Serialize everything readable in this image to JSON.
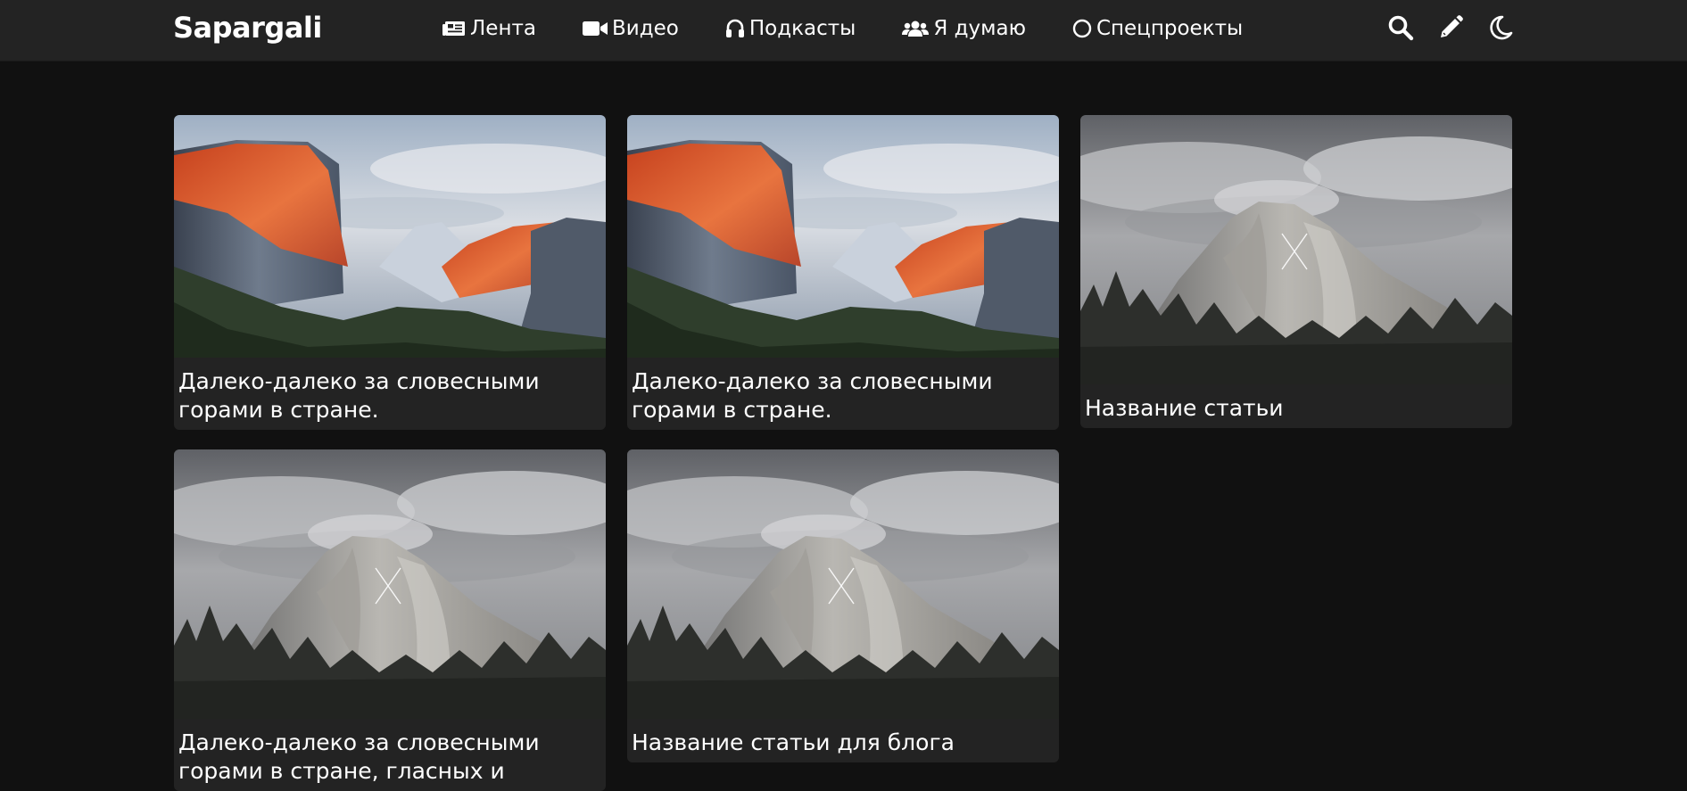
{
  "site": {
    "brand": "Sapargali"
  },
  "nav": {
    "items": [
      {
        "label": "Лента",
        "icon": "newspaper-icon"
      },
      {
        "label": "Видео",
        "icon": "video-camera-icon"
      },
      {
        "label": "Подкасты",
        "icon": "headphones-icon"
      },
      {
        "label": "Я думаю",
        "icon": "users-icon"
      },
      {
        "label": "Спецпроекты",
        "icon": "circle-icon"
      }
    ],
    "tools": [
      {
        "icon": "search-icon"
      },
      {
        "icon": "pencil-icon"
      },
      {
        "icon": "moon-icon"
      }
    ]
  },
  "cards": [
    {
      "title": "Далеко-далеко за словесными горами в стране.",
      "image": "el-capitan-sunset"
    },
    {
      "title": "Далеко-далеко за словесными горами в стране.",
      "image": "el-capitan-sunset"
    },
    {
      "title": "Название статьи",
      "image": "yosemite-cloudy"
    },
    {
      "title": "Далеко-далеко за словесными горами в стране, гласных и",
      "image": "yosemite-cloudy"
    },
    {
      "title": "Название статьи для блога",
      "image": "yosemite-cloudy"
    }
  ],
  "colors": {
    "background": "#111111",
    "navbar": "#232323",
    "card": "#232323",
    "text": "#ffffff"
  }
}
